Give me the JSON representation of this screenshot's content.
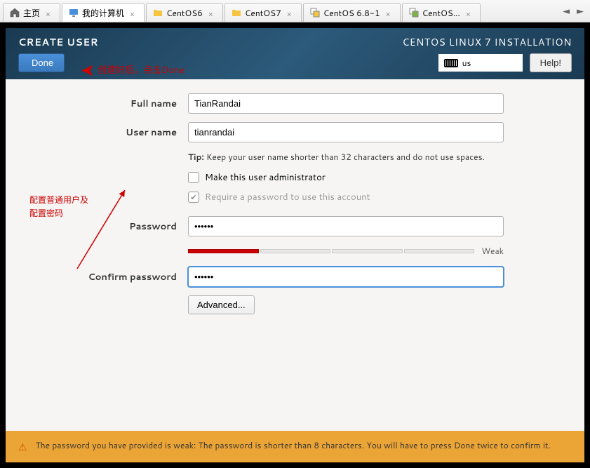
{
  "tabs": [
    {
      "label": "主页",
      "icon": "home"
    },
    {
      "label": "我的计算机",
      "icon": "monitor"
    },
    {
      "label": "CentOS6",
      "icon": "folder"
    },
    {
      "label": "CentOS7",
      "icon": "folder"
    },
    {
      "label": "CentOS 6.8-1",
      "icon": "vm"
    },
    {
      "label": "CentOS...",
      "icon": "vm"
    }
  ],
  "header": {
    "title": "CREATE USER",
    "done": "Done",
    "install_title": "CENTOS LINUX 7 INSTALLATION",
    "keyboard": "us",
    "help": "Help!"
  },
  "annotations": {
    "done_hint": "创建好后，点击Done",
    "side_line1": "配置普通用户及",
    "side_line2": "配置密码"
  },
  "form": {
    "full_name_label": "Full name",
    "full_name_value": "TianRandai",
    "user_name_label": "User name",
    "user_name_value": "tianrandai",
    "tip_bold": "Tip:",
    "tip_text": "Keep your user name shorter than 32 characters and do not use spaces.",
    "admin_label": "Make this user administrator",
    "require_pw_label": "Require a password to use this account",
    "password_label": "Password",
    "password_value": "••••••",
    "strength_label": "Weak",
    "confirm_label": "Confirm password",
    "confirm_value": "••••••",
    "advanced": "Advanced..."
  },
  "warning": {
    "text": "The password you have provided is weak: The password is shorter than 8 characters. You will have to press Done twice to confirm it."
  }
}
